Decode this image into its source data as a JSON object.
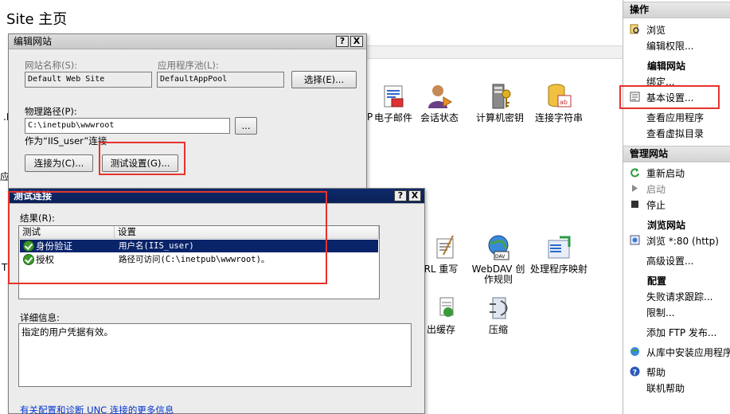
{
  "page": {
    "title": "Site 主页"
  },
  "features": {
    "email": "电子邮件",
    "email_prefix": "P",
    "session": "会话状态",
    "machinekey": "计算机密钥",
    "connstrings": "连接字符串",
    "rewrite": "RL 重写",
    "webdav": "WebDAV 创作规则",
    "handlers": "处理程序映射",
    "outputcache": "出缓存",
    "compression": "压缩",
    "partial_n": ".N",
    "partial_ying": "应",
    "partial_t": "T"
  },
  "actions": {
    "header": "操作",
    "browse": "浏览",
    "edit_permissions": "编辑权限...",
    "edit_site_section": "编辑网站",
    "bindings": "绑定...",
    "basic_settings": "基本设置...",
    "view_apps": "查看应用程序",
    "view_vdirs": "查看虚拟目录",
    "manage_header": "管理网站",
    "restart": "重新启动",
    "start": "启动",
    "stop": "停止",
    "browse_section": "浏览网站",
    "browse_80": "浏览 *:80 (http)",
    "advanced": "高级设置...",
    "config_section": "配置",
    "failed_trace": "失败请求跟踪...",
    "limits": "限制...",
    "add_ftp": "添加 FTP 发布...",
    "install_gallery": "从库中安装应用程序",
    "help": "帮助",
    "online_help": "联机帮助"
  },
  "edit_site": {
    "title": "编辑网站",
    "help_btn": "?",
    "close_btn": "X",
    "site_name_label": "网站名称(S):",
    "site_name": "Default Web Site",
    "app_pool_label": "应用程序池(L):",
    "app_pool": "DefaultAppPool",
    "select_btn": "选择(E)...",
    "physical_path_label": "物理路径(P):",
    "physical_path": "C:\\inetpub\\wwwroot",
    "browse_btn": "...",
    "connect_as_text": "作为“IIS_user”连接",
    "connect_as_btn": "连接为(C)...",
    "test_btn": "测试设置(G)..."
  },
  "test_conn": {
    "title": "测试连接",
    "help_btn": "?",
    "close_btn": "X",
    "results_label": "结果(R):",
    "col_test": "测试",
    "col_setting": "设置",
    "rows": [
      {
        "test": "身份验证",
        "setting": "用户名(IIS_user)"
      },
      {
        "test": "授权",
        "setting": "路径可访问(C:\\inetpub\\wwwroot)。"
      }
    ],
    "details_label": "详细信息:",
    "details_text": "指定的用户凭据有效。",
    "more_link": "有关配置和诊断 UNC 连接的更多信息"
  },
  "colors": {
    "highlight": "#e8322c",
    "title_active": "#0a2158",
    "selection": "#0a246a"
  }
}
